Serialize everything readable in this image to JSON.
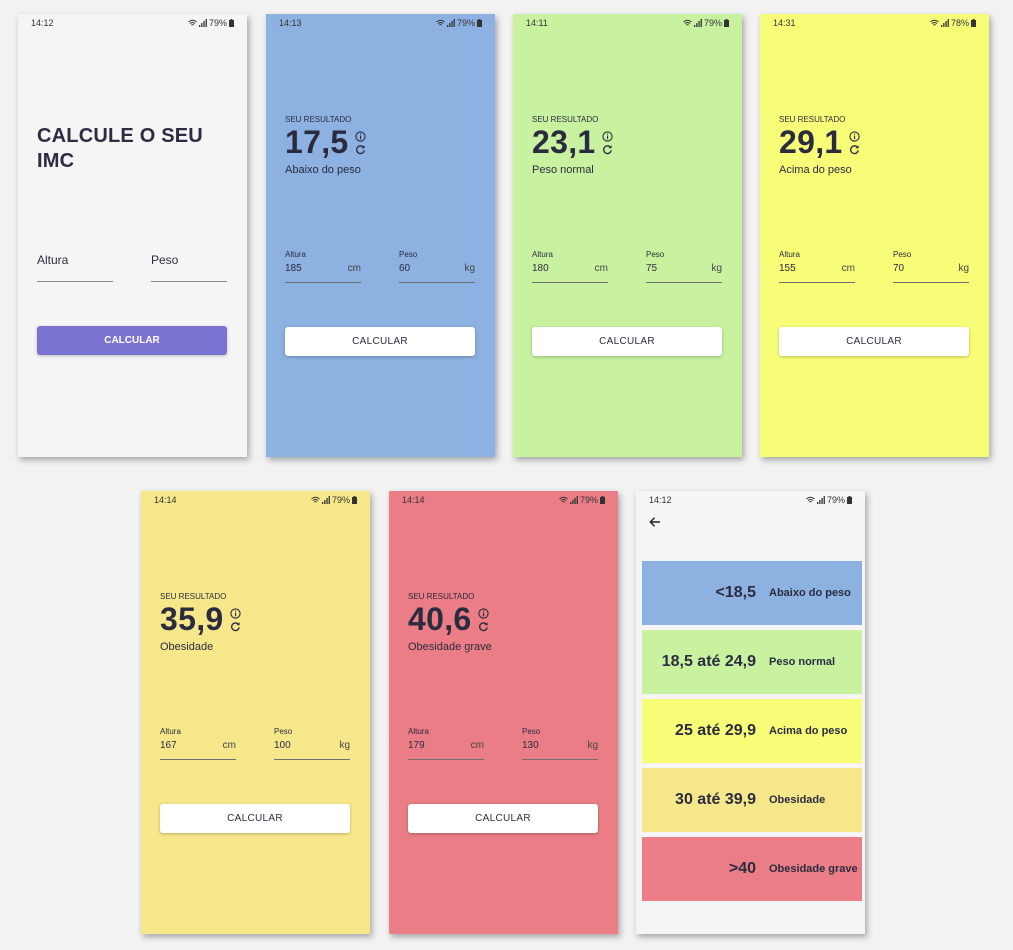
{
  "home": {
    "status": {
      "time": "14:12",
      "battery": "79%"
    },
    "title": "CALCULE O SEU IMC",
    "height_label": "Altura",
    "weight_label": "Peso",
    "button_label": "CALCULAR",
    "colors": {
      "background": "#f5f5f5",
      "button": "#7b73d1"
    }
  },
  "results": [
    {
      "status": {
        "time": "14:13",
        "battery": "79%"
      },
      "label": "SEU RESULTADO",
      "value": "17,5",
      "category": "Abaixo do peso",
      "height_label": "Altura",
      "height": "185",
      "height_unit": "cm",
      "weight_label": "Peso",
      "weight": "60",
      "weight_unit": "kg",
      "button_label": "CALCULAR",
      "color": "#8db1e0"
    },
    {
      "status": {
        "time": "14:11",
        "battery": "79%"
      },
      "label": "SEU RESULTADO",
      "value": "23,1",
      "category": "Peso normal",
      "height_label": "Altura",
      "height": "180",
      "height_unit": "cm",
      "weight_label": "Peso",
      "weight": "75",
      "weight_unit": "kg",
      "button_label": "CALCULAR",
      "color": "#c8f2a0"
    },
    {
      "status": {
        "time": "14:31",
        "battery": "78%"
      },
      "label": "SEU RESULTADO",
      "value": "29,1",
      "category": "Acima do peso",
      "height_label": "Altura",
      "height": "155",
      "height_unit": "cm",
      "weight_label": "Peso",
      "weight": "70",
      "weight_unit": "kg",
      "button_label": "CALCULAR",
      "color": "#f8fd78"
    },
    {
      "status": {
        "time": "14:14",
        "battery": "79%"
      },
      "label": "SEU RESULTADO",
      "value": "35,9",
      "category": "Obesidade",
      "height_label": "Altura",
      "height": "167",
      "height_unit": "cm",
      "weight_label": "Peso",
      "weight": "100",
      "weight_unit": "kg",
      "button_label": "CALCULAR",
      "color": "#f6e88a"
    },
    {
      "status": {
        "time": "14:14",
        "battery": "79%"
      },
      "label": "SEU RESULTADO",
      "value": "40,6",
      "category": "Obesidade grave",
      "height_label": "Altura",
      "height": "179",
      "height_unit": "cm",
      "weight_label": "Peso",
      "weight": "130",
      "weight_unit": "kg",
      "button_label": "CALCULAR",
      "color": "#ea7d86"
    }
  ],
  "table": {
    "status": {
      "time": "14:12",
      "battery": "79%"
    },
    "back_icon": "arrow-left-icon",
    "rows": [
      {
        "range": "<18,5",
        "category": "Abaixo do peso",
        "color": "#8db1e0"
      },
      {
        "range": "18,5 até 24,9",
        "category": "Peso normal",
        "color": "#c8f2a0"
      },
      {
        "range": "25 até 29,9",
        "category": "Acima do peso",
        "color": "#f8fd78"
      },
      {
        "range": "30 até 39,9",
        "category": "Obesidade",
        "color": "#f6e88a"
      },
      {
        "range": ">40",
        "category": "Obesidade grave",
        "color": "#ea7d86"
      }
    ]
  }
}
